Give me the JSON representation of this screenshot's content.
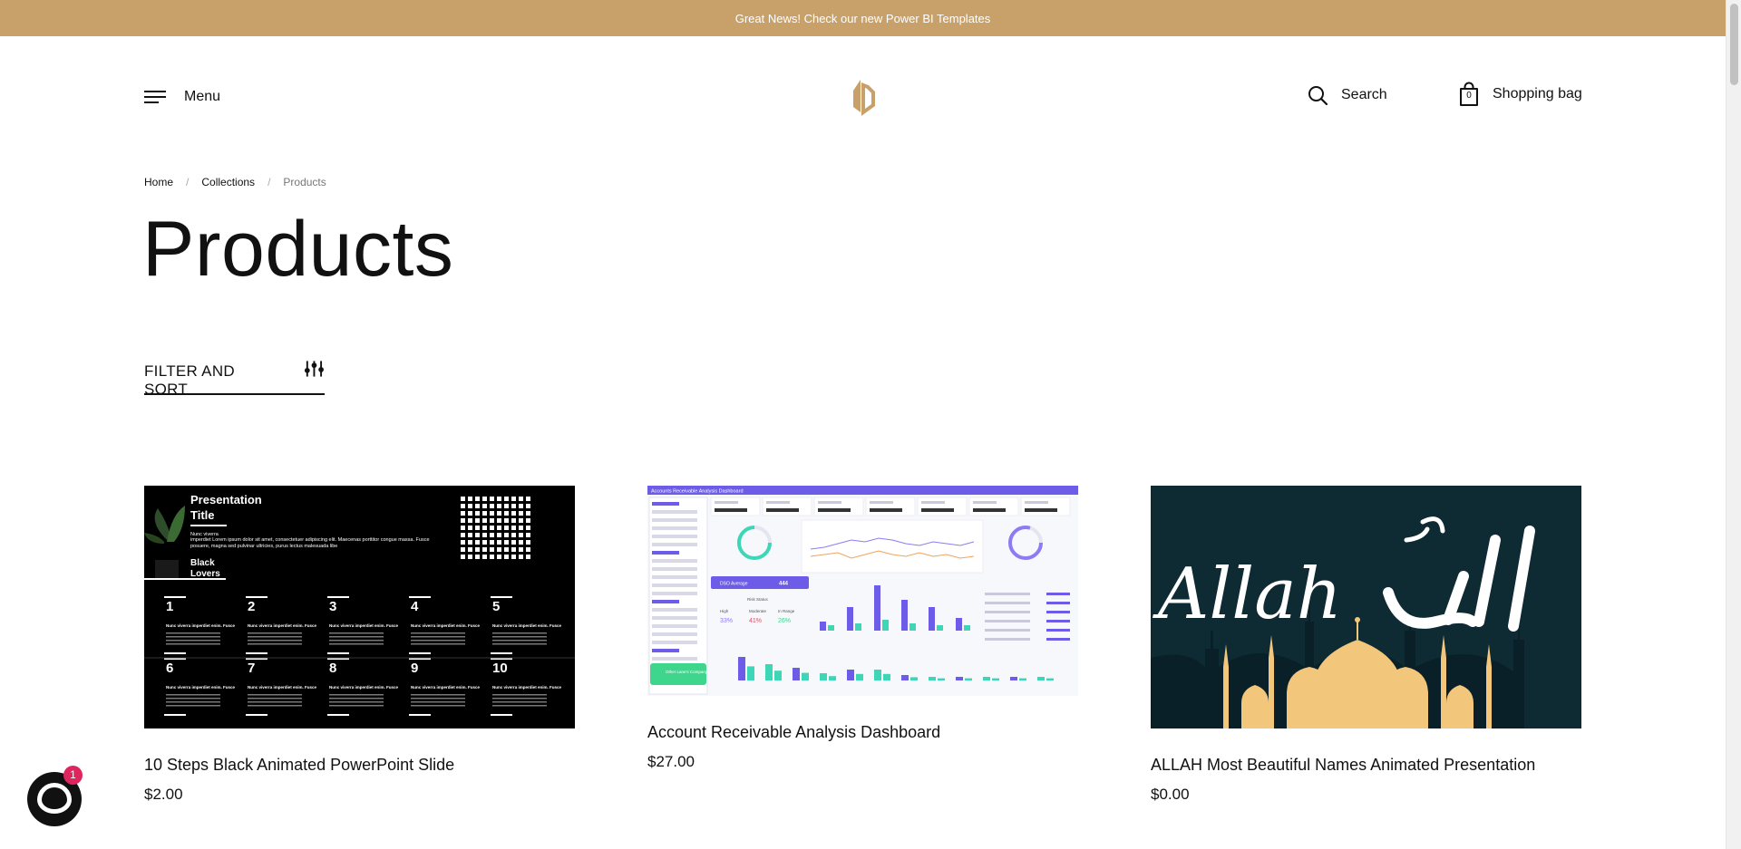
{
  "announcement": "Great News! Check our new Power BI Templates",
  "header": {
    "menu_label": "Menu",
    "search_label": "Search",
    "bag_label": "Shopping bag",
    "bag_count": "0"
  },
  "breadcrumb": {
    "items": [
      "Home",
      "Collections",
      "Products"
    ],
    "separator": "/"
  },
  "page_title": "Products",
  "filter_label": "FILTER AND SORT",
  "products": [
    {
      "title": "10 Steps Black Animated PowerPoint Slide",
      "price": "$2.00",
      "image": {
        "heading": "Presentation Title",
        "heading_line1": "Presentation",
        "heading_line2": "Title",
        "subtitle": "Nunc viverra",
        "body": "imperdiet Lorem ipsum dolor sit amet, consectetuer adipiscing elit. Maecenas porttitor congue massa. Fusce posuere, magna sed pulvinar ultricies, purus lectus malesuada libe",
        "tag_line1": "Black",
        "tag_line2": "Lovers",
        "steps": [
          "1",
          "2",
          "3",
          "4",
          "5",
          "6",
          "7",
          "8",
          "9",
          "10"
        ],
        "step_heading": "Nunc viverra imperdiet enim. Fusce"
      }
    },
    {
      "title": "Account Receivable Analysis Dashboard",
      "price": "$27.00",
      "image": {
        "header": "Accounts Receivable Analysis Dashboard",
        "dso_label": "DSO Average",
        "dso_value": "444",
        "risk_title": "Risk Status",
        "risk": [
          {
            "label": "High",
            "value": "33%"
          },
          {
            "label": "Moderate",
            "value": "41%"
          },
          {
            "label": "In Range",
            "value": "26%"
          }
        ],
        "company": "Other Lane's Company"
      }
    },
    {
      "title": "ALLAH Most Beautiful Names Animated Presentation",
      "price": "$0.00",
      "image": {
        "script_text": "Allah"
      }
    }
  ],
  "chat_badge": "1",
  "colors": {
    "announcement_bg": "#c8a06a",
    "logo": "#c8a06a",
    "dashboard_accent": "#6c5ce7",
    "islamic_bg": "#0e2a33",
    "mosque": "#f3c77b"
  }
}
